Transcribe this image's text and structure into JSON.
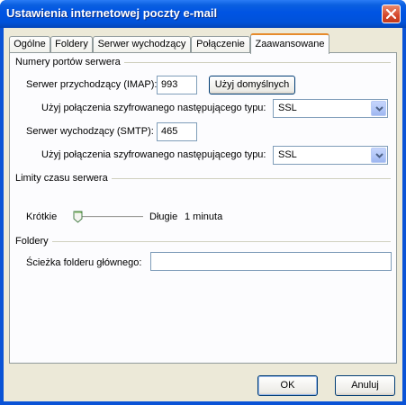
{
  "window": {
    "title": "Ustawienia internetowej poczty e-mail"
  },
  "tabs": [
    {
      "label": "Ogólne",
      "active": false
    },
    {
      "label": "Foldery",
      "active": false
    },
    {
      "label": "Serwer wychodzący",
      "active": false
    },
    {
      "label": "Połączenie",
      "active": false
    },
    {
      "label": "Zaawansowane",
      "active": true
    }
  ],
  "ports": {
    "section_label": "Numery portów serwera",
    "incoming_label": "Serwer przychodzący (IMAP):",
    "incoming_value": "993",
    "default_button": "Użyj domyślnych",
    "encryption_label_1": "Użyj połączenia szyfrowanego następującego typu:",
    "encryption_value_1": "SSL",
    "outgoing_label": "Serwer wychodzący (SMTP):",
    "outgoing_value": "465",
    "encryption_label_2": "Użyj połączenia szyfrowanego następującego typu:",
    "encryption_value_2": "SSL"
  },
  "timeouts": {
    "section_label": "Limity czasu serwera",
    "short_label": "Krótkie",
    "long_label": "Długie",
    "value_text": "1 minuta",
    "slider_level": 0
  },
  "folders": {
    "section_label": "Foldery",
    "root_path_label": "Ścieżka folderu głównego:",
    "root_path_value": ""
  },
  "footer": {
    "ok_label": "OK",
    "cancel_label": "Anuluj"
  }
}
